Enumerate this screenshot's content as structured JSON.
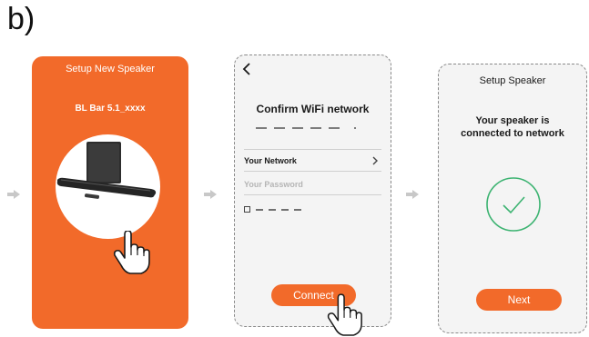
{
  "step_label": "b)",
  "screen1": {
    "title": "Setup New Speaker",
    "device_name": "BL Bar 5.1_xxxx"
  },
  "screen2": {
    "back_icon": "chevron-left-icon",
    "title": "Confirm WiFi network",
    "network_label": "Your Network",
    "password_placeholder": "Your Password",
    "connect_label": "Connect"
  },
  "screen3": {
    "title": "Setup Speaker",
    "status_line1": "Your speaker is",
    "status_line2": "connected to network",
    "next_label": "Next"
  },
  "colors": {
    "accent": "#f26a2a",
    "success": "#3cb371",
    "arrow": "#c8c8c8"
  }
}
